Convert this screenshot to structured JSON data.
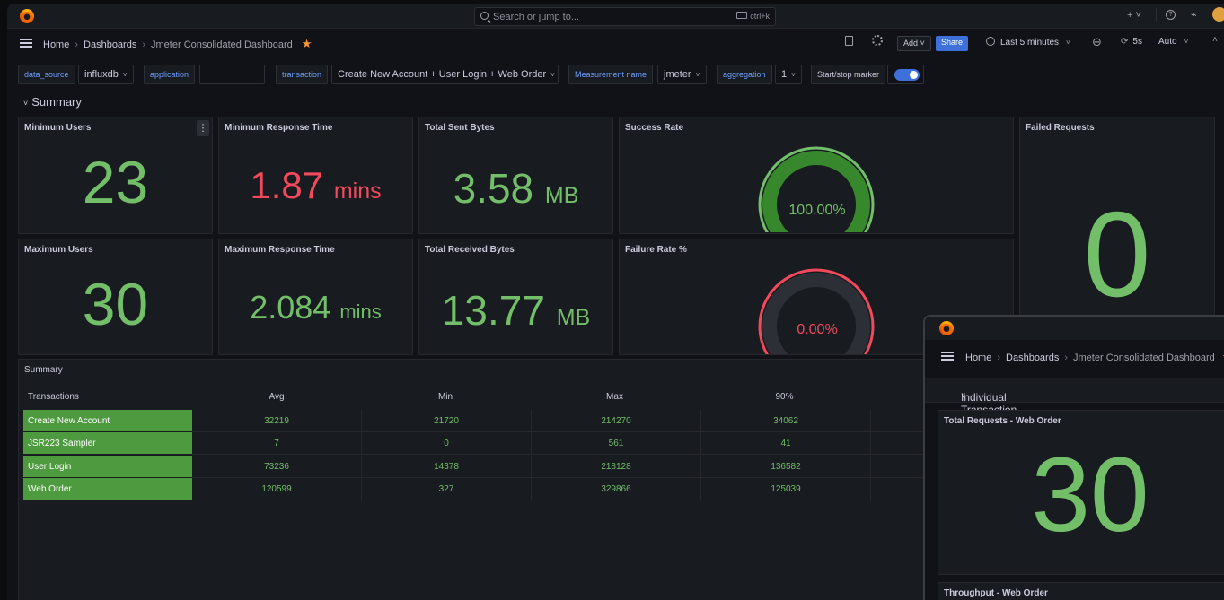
{
  "topbar": {
    "search_placeholder": "Search or jump to...",
    "search_shortcut": "ctrl+k",
    "plus_label": "+ ˅"
  },
  "breadcrumb": {
    "home": "Home",
    "dashboards": "Dashboards",
    "current": "Jmeter Consolidated Dashboard"
  },
  "toolbar": {
    "add_label": "Add ˅",
    "share_label": "Share",
    "time_range": "Last 5 minutes",
    "refresh_interval": "5s",
    "auto_label": "Auto"
  },
  "variables": [
    {
      "label": "data_source",
      "value": "influxdb"
    },
    {
      "label": "application",
      "value": ""
    },
    {
      "label": "transaction",
      "value": "Create New Account + User Login + Web Order"
    },
    {
      "label": "Measurement name",
      "value": "jmeter"
    },
    {
      "label": "aggregation",
      "value": "1"
    },
    {
      "label": "Start/stop marker",
      "value": "on"
    }
  ],
  "section": {
    "title": "Summary"
  },
  "panels": {
    "min_users": {
      "title": "Minimum Users",
      "value": "23"
    },
    "min_resp": {
      "title": "Minimum Response Time",
      "value": "1.87",
      "unit": "mins"
    },
    "sent_bytes": {
      "title": "Total Sent Bytes",
      "value": "3.58",
      "unit": "MB"
    },
    "success_rate": {
      "title": "Success Rate",
      "value": "100.00%",
      "fraction": 1.0
    },
    "failed_requests": {
      "title": "Failed Requests",
      "value": "0"
    },
    "max_users": {
      "title": "Maximum Users",
      "value": "30"
    },
    "max_resp": {
      "title": "Maximum Response Time",
      "value": "2.084",
      "unit": "mins"
    },
    "recv_bytes": {
      "title": "Total Received Bytes",
      "value": "13.77",
      "unit": "MB"
    },
    "failure_rate": {
      "title": "Failure Rate %",
      "value": "0.00%",
      "fraction": 0.0
    }
  },
  "summary_table": {
    "title": "Summary",
    "columns": [
      "Transactions",
      "Avg",
      "Min",
      "Max",
      "90%"
    ],
    "rows": [
      [
        "Create New Account",
        "32219",
        "21720",
        "214270",
        "34062"
      ],
      [
        "JSR223 Sampler",
        "7",
        "0",
        "561",
        "41"
      ],
      [
        "User Login",
        "73236",
        "14378",
        "218128",
        "136582"
      ],
      [
        "Web Order",
        "120599",
        "327",
        "329866",
        "125039"
      ]
    ]
  },
  "overlay": {
    "breadcrumb": {
      "home": "Home",
      "dashboards": "Dashboards",
      "current": "Jmeter Consolidated Dashboard"
    },
    "section_title": "Individual Transaction - Web Order",
    "total_requests": {
      "title": "Total Requests - Web Order",
      "value": "30"
    },
    "throughput": {
      "title": "Throughput - Web Order"
    }
  },
  "colors": {
    "green": "#73bf69",
    "red": "#f2495c",
    "accent": "#3d71d9",
    "table_green": "#4e9a3e"
  }
}
